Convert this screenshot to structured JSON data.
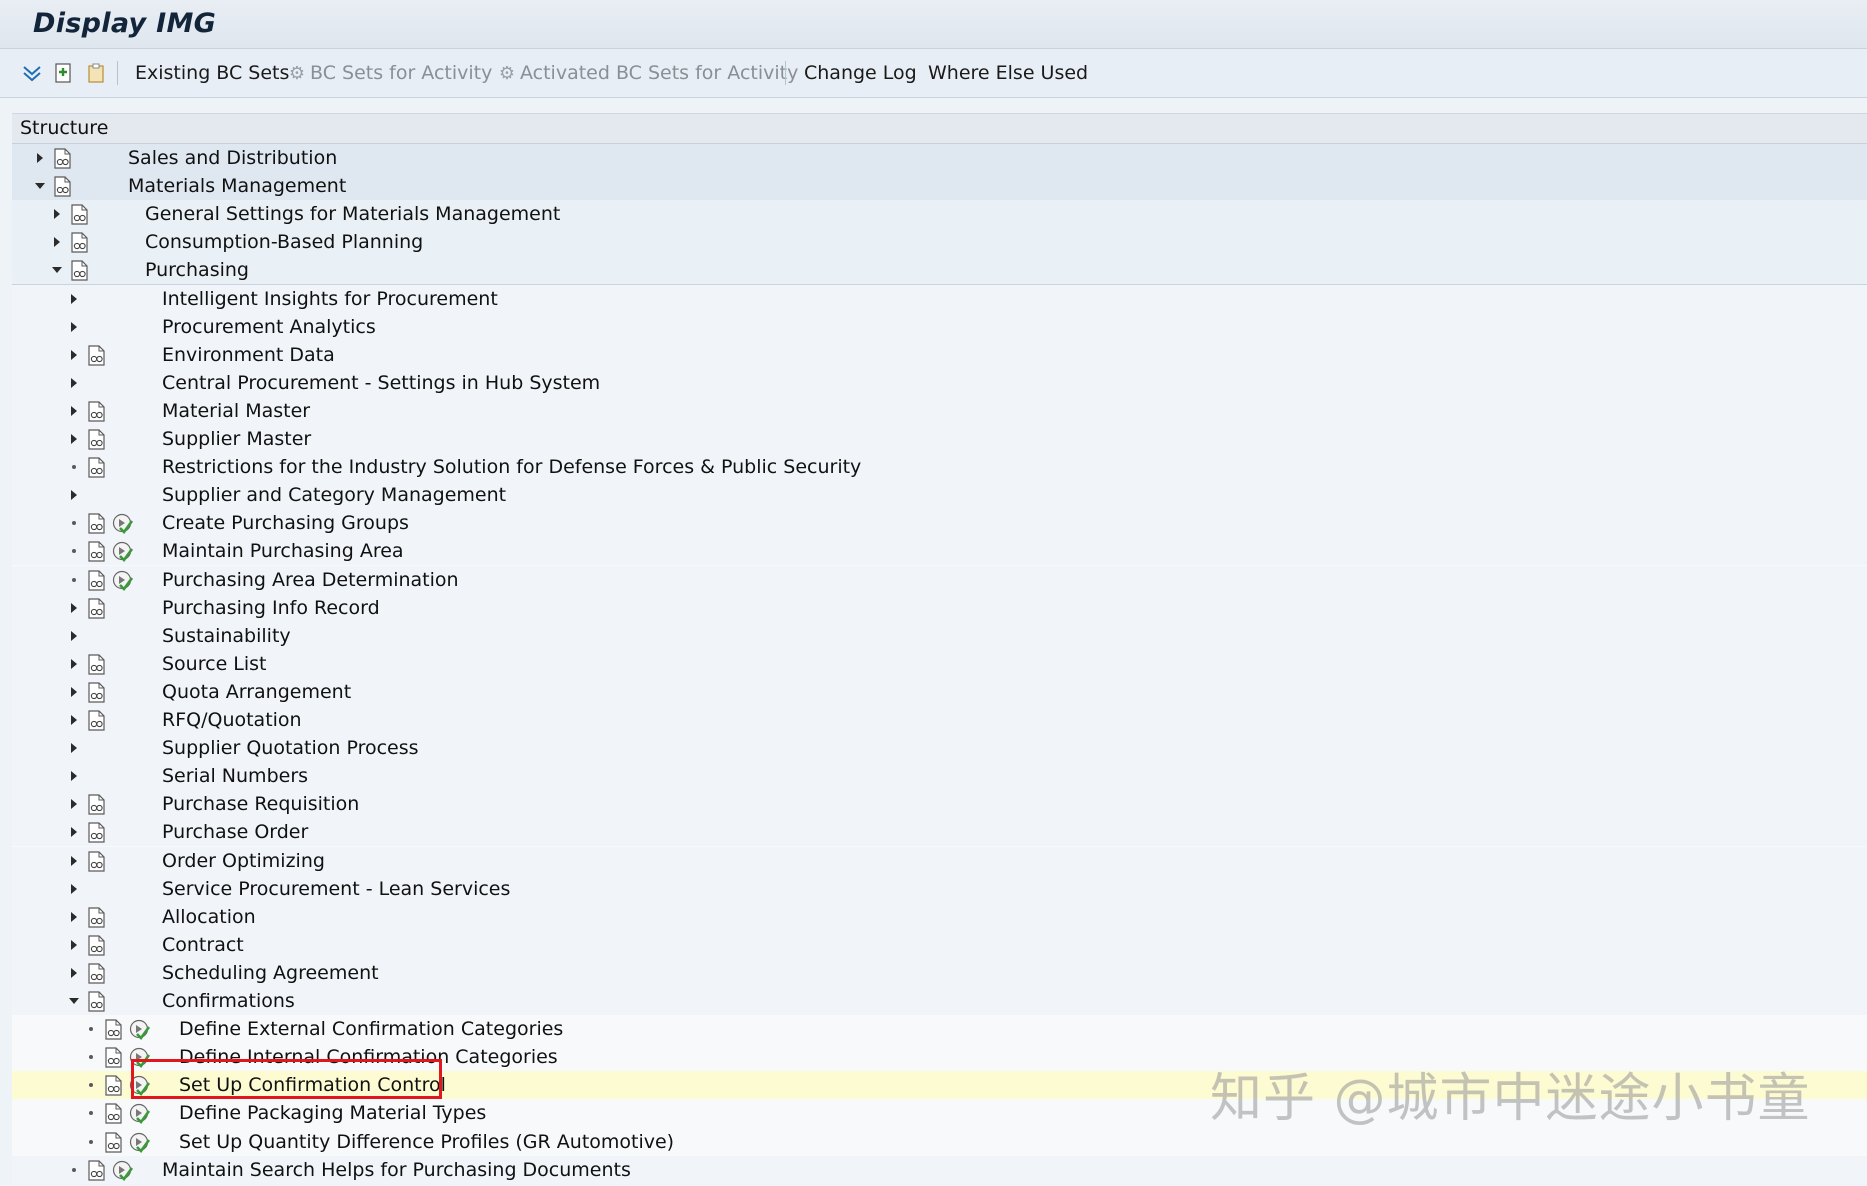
{
  "window": {
    "title": "Display IMG"
  },
  "toolbar": {
    "existing_bc_sets": "Existing BC Sets",
    "bc_sets_for_activity": "BC Sets for Activity",
    "activated_bc_sets": "Activated BC Sets for Activity",
    "change_log": "Change Log",
    "where_else_used": "Where Else Used"
  },
  "structure": {
    "header": "Structure",
    "rows": [
      {
        "label": "Sales and Distribution",
        "level": 0,
        "expander": "collapsed",
        "doc": true,
        "activity": false
      },
      {
        "label": "Materials Management",
        "level": 0,
        "expander": "expanded",
        "doc": true,
        "activity": false
      },
      {
        "label": "General Settings for Materials Management",
        "level": 1,
        "expander": "collapsed",
        "doc": true,
        "activity": false
      },
      {
        "label": "Consumption-Based Planning",
        "level": 1,
        "expander": "collapsed",
        "doc": true,
        "activity": false
      },
      {
        "label": "Purchasing",
        "level": 1,
        "expander": "expanded",
        "doc": true,
        "activity": false
      },
      {
        "label": "Intelligent Insights for Procurement",
        "level": 2,
        "expander": "collapsed",
        "doc": false,
        "activity": false
      },
      {
        "label": "Procurement Analytics",
        "level": 2,
        "expander": "collapsed",
        "doc": false,
        "activity": false
      },
      {
        "label": "Environment Data",
        "level": 2,
        "expander": "collapsed",
        "doc": true,
        "activity": false
      },
      {
        "label": "Central Procurement - Settings in Hub System",
        "level": 2,
        "expander": "collapsed",
        "doc": false,
        "activity": false
      },
      {
        "label": "Material Master",
        "level": 2,
        "expander": "collapsed",
        "doc": true,
        "activity": false
      },
      {
        "label": "Supplier Master",
        "level": 2,
        "expander": "collapsed",
        "doc": true,
        "activity": false
      },
      {
        "label": "Restrictions for the Industry Solution for Defense Forces & Public Security",
        "level": 2,
        "expander": "leaf",
        "doc": true,
        "activity": false
      },
      {
        "label": "Supplier and Category Management",
        "level": 2,
        "expander": "collapsed",
        "doc": false,
        "activity": false
      },
      {
        "label": "Create Purchasing Groups",
        "level": 2,
        "expander": "leaf",
        "doc": true,
        "activity": true
      },
      {
        "label": "Maintain Purchasing Area",
        "level": 2,
        "expander": "leaf",
        "doc": true,
        "activity": true
      },
      {
        "label": "Purchasing Area Determination",
        "level": 2,
        "expander": "leaf",
        "doc": true,
        "activity": true
      },
      {
        "label": "Purchasing Info Record",
        "level": 2,
        "expander": "collapsed",
        "doc": true,
        "activity": false
      },
      {
        "label": "Sustainability",
        "level": 2,
        "expander": "collapsed",
        "doc": false,
        "activity": false
      },
      {
        "label": "Source List",
        "level": 2,
        "expander": "collapsed",
        "doc": true,
        "activity": false
      },
      {
        "label": "Quota Arrangement",
        "level": 2,
        "expander": "collapsed",
        "doc": true,
        "activity": false
      },
      {
        "label": "RFQ/Quotation",
        "level": 2,
        "expander": "collapsed",
        "doc": true,
        "activity": false
      },
      {
        "label": "Supplier Quotation Process",
        "level": 2,
        "expander": "collapsed",
        "doc": false,
        "activity": false
      },
      {
        "label": "Serial Numbers",
        "level": 2,
        "expander": "collapsed",
        "doc": false,
        "activity": false
      },
      {
        "label": "Purchase Requisition",
        "level": 2,
        "expander": "collapsed",
        "doc": true,
        "activity": false
      },
      {
        "label": "Purchase Order",
        "level": 2,
        "expander": "collapsed",
        "doc": true,
        "activity": false
      },
      {
        "label": "Order Optimizing",
        "level": 2,
        "expander": "collapsed",
        "doc": true,
        "activity": false
      },
      {
        "label": "Service Procurement - Lean Services",
        "level": 2,
        "expander": "collapsed",
        "doc": false,
        "activity": false
      },
      {
        "label": "Allocation",
        "level": 2,
        "expander": "collapsed",
        "doc": true,
        "activity": false
      },
      {
        "label": "Contract",
        "level": 2,
        "expander": "collapsed",
        "doc": true,
        "activity": false
      },
      {
        "label": "Scheduling Agreement",
        "level": 2,
        "expander": "collapsed",
        "doc": true,
        "activity": false
      },
      {
        "label": "Confirmations",
        "level": 2,
        "expander": "expanded",
        "doc": true,
        "activity": false
      },
      {
        "label": "Define External Confirmation Categories",
        "level": 3,
        "expander": "leaf",
        "doc": true,
        "activity": true
      },
      {
        "label": "Define Internal Confirmation Categories",
        "level": 3,
        "expander": "leaf",
        "doc": true,
        "activity": true
      },
      {
        "label": "Set Up Confirmation Control",
        "level": 3,
        "expander": "leaf",
        "doc": true,
        "activity": true,
        "selected": true
      },
      {
        "label": "Define Packaging Material Types",
        "level": 3,
        "expander": "leaf",
        "doc": true,
        "activity": true
      },
      {
        "label": "Set Up Quantity Difference Profiles (GR Automotive)",
        "level": 3,
        "expander": "leaf",
        "doc": true,
        "activity": true
      },
      {
        "label": "Maintain Search Helps for Purchasing Documents",
        "level": 2,
        "expander": "leaf",
        "doc": true,
        "activity": true
      }
    ]
  },
  "watermark": "知乎 @城市中迷途小书童",
  "colors": {
    "accent_green": "#3a9a3a",
    "highlight": "#e0181e",
    "selected_row": "#fdfbd2"
  }
}
